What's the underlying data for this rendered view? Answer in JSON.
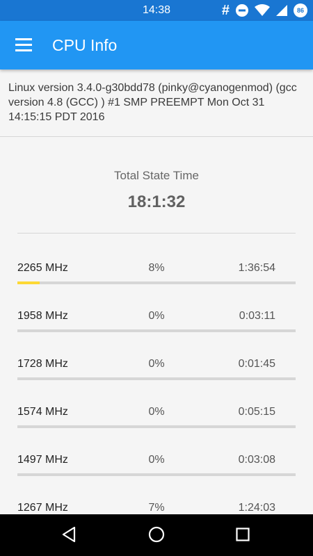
{
  "status": {
    "time": "14:38",
    "hash": "#",
    "battery": "86"
  },
  "app_bar": {
    "title": "CPU Info",
    "menu_icon": "hamburger-menu-icon"
  },
  "kernel": {
    "text": "Linux version 3.4.0-g30bdd78 (pinky@cyanogenmod) (gcc version 4.8 (GCC) ) #1 SMP PREEMPT Mon Oct 31 14:15:15 PDT 2016"
  },
  "total": {
    "label": "Total State Time",
    "value": "18:1:32"
  },
  "states": [
    {
      "freq": "2265 MHz",
      "percent": "8%",
      "time": "1:36:54",
      "fraction": 0.08
    },
    {
      "freq": "1958 MHz",
      "percent": "0%",
      "time": "0:03:11",
      "fraction": 0
    },
    {
      "freq": "1728 MHz",
      "percent": "0%",
      "time": "0:01:45",
      "fraction": 0
    },
    {
      "freq": "1574 MHz",
      "percent": "0%",
      "time": "0:05:15",
      "fraction": 0
    },
    {
      "freq": "1497 MHz",
      "percent": "0%",
      "time": "0:03:08",
      "fraction": 0
    },
    {
      "freq": "1267 MHz",
      "percent": "7%",
      "time": "1:24:03",
      "fraction": 0.07
    }
  ],
  "colors": {
    "status_bar": "#1976d2",
    "app_bar": "#2196f3",
    "bar_fill": "#fdd835",
    "bar_track": "#d6d6d6"
  }
}
